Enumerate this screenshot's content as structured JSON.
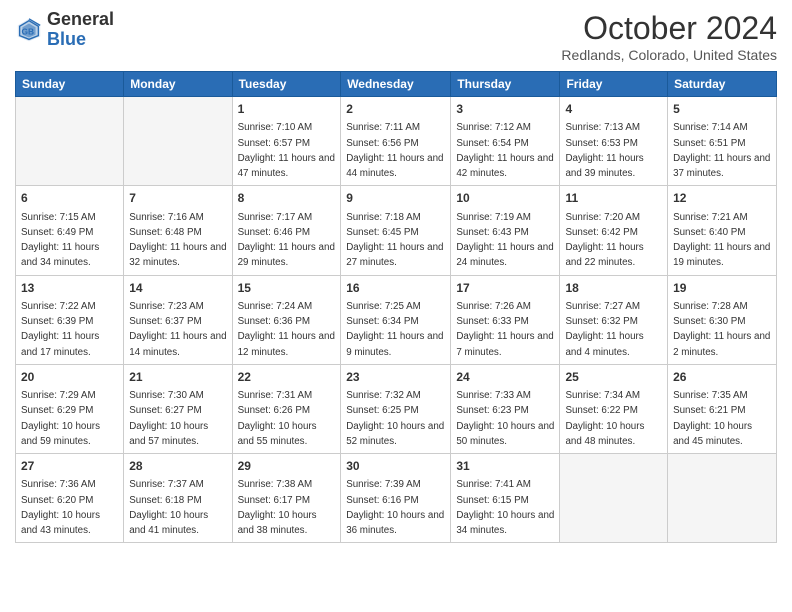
{
  "header": {
    "logo_general": "General",
    "logo_blue": "Blue",
    "title": "October 2024",
    "location": "Redlands, Colorado, United States"
  },
  "days_of_week": [
    "Sunday",
    "Monday",
    "Tuesday",
    "Wednesday",
    "Thursday",
    "Friday",
    "Saturday"
  ],
  "weeks": [
    [
      {
        "day": "",
        "detail": ""
      },
      {
        "day": "",
        "detail": ""
      },
      {
        "day": "1",
        "detail": "Sunrise: 7:10 AM\nSunset: 6:57 PM\nDaylight: 11 hours and 47 minutes."
      },
      {
        "day": "2",
        "detail": "Sunrise: 7:11 AM\nSunset: 6:56 PM\nDaylight: 11 hours and 44 minutes."
      },
      {
        "day": "3",
        "detail": "Sunrise: 7:12 AM\nSunset: 6:54 PM\nDaylight: 11 hours and 42 minutes."
      },
      {
        "day": "4",
        "detail": "Sunrise: 7:13 AM\nSunset: 6:53 PM\nDaylight: 11 hours and 39 minutes."
      },
      {
        "day": "5",
        "detail": "Sunrise: 7:14 AM\nSunset: 6:51 PM\nDaylight: 11 hours and 37 minutes."
      }
    ],
    [
      {
        "day": "6",
        "detail": "Sunrise: 7:15 AM\nSunset: 6:49 PM\nDaylight: 11 hours and 34 minutes."
      },
      {
        "day": "7",
        "detail": "Sunrise: 7:16 AM\nSunset: 6:48 PM\nDaylight: 11 hours and 32 minutes."
      },
      {
        "day": "8",
        "detail": "Sunrise: 7:17 AM\nSunset: 6:46 PM\nDaylight: 11 hours and 29 minutes."
      },
      {
        "day": "9",
        "detail": "Sunrise: 7:18 AM\nSunset: 6:45 PM\nDaylight: 11 hours and 27 minutes."
      },
      {
        "day": "10",
        "detail": "Sunrise: 7:19 AM\nSunset: 6:43 PM\nDaylight: 11 hours and 24 minutes."
      },
      {
        "day": "11",
        "detail": "Sunrise: 7:20 AM\nSunset: 6:42 PM\nDaylight: 11 hours and 22 minutes."
      },
      {
        "day": "12",
        "detail": "Sunrise: 7:21 AM\nSunset: 6:40 PM\nDaylight: 11 hours and 19 minutes."
      }
    ],
    [
      {
        "day": "13",
        "detail": "Sunrise: 7:22 AM\nSunset: 6:39 PM\nDaylight: 11 hours and 17 minutes."
      },
      {
        "day": "14",
        "detail": "Sunrise: 7:23 AM\nSunset: 6:37 PM\nDaylight: 11 hours and 14 minutes."
      },
      {
        "day": "15",
        "detail": "Sunrise: 7:24 AM\nSunset: 6:36 PM\nDaylight: 11 hours and 12 minutes."
      },
      {
        "day": "16",
        "detail": "Sunrise: 7:25 AM\nSunset: 6:34 PM\nDaylight: 11 hours and 9 minutes."
      },
      {
        "day": "17",
        "detail": "Sunrise: 7:26 AM\nSunset: 6:33 PM\nDaylight: 11 hours and 7 minutes."
      },
      {
        "day": "18",
        "detail": "Sunrise: 7:27 AM\nSunset: 6:32 PM\nDaylight: 11 hours and 4 minutes."
      },
      {
        "day": "19",
        "detail": "Sunrise: 7:28 AM\nSunset: 6:30 PM\nDaylight: 11 hours and 2 minutes."
      }
    ],
    [
      {
        "day": "20",
        "detail": "Sunrise: 7:29 AM\nSunset: 6:29 PM\nDaylight: 10 hours and 59 minutes."
      },
      {
        "day": "21",
        "detail": "Sunrise: 7:30 AM\nSunset: 6:27 PM\nDaylight: 10 hours and 57 minutes."
      },
      {
        "day": "22",
        "detail": "Sunrise: 7:31 AM\nSunset: 6:26 PM\nDaylight: 10 hours and 55 minutes."
      },
      {
        "day": "23",
        "detail": "Sunrise: 7:32 AM\nSunset: 6:25 PM\nDaylight: 10 hours and 52 minutes."
      },
      {
        "day": "24",
        "detail": "Sunrise: 7:33 AM\nSunset: 6:23 PM\nDaylight: 10 hours and 50 minutes."
      },
      {
        "day": "25",
        "detail": "Sunrise: 7:34 AM\nSunset: 6:22 PM\nDaylight: 10 hours and 48 minutes."
      },
      {
        "day": "26",
        "detail": "Sunrise: 7:35 AM\nSunset: 6:21 PM\nDaylight: 10 hours and 45 minutes."
      }
    ],
    [
      {
        "day": "27",
        "detail": "Sunrise: 7:36 AM\nSunset: 6:20 PM\nDaylight: 10 hours and 43 minutes."
      },
      {
        "day": "28",
        "detail": "Sunrise: 7:37 AM\nSunset: 6:18 PM\nDaylight: 10 hours and 41 minutes."
      },
      {
        "day": "29",
        "detail": "Sunrise: 7:38 AM\nSunset: 6:17 PM\nDaylight: 10 hours and 38 minutes."
      },
      {
        "day": "30",
        "detail": "Sunrise: 7:39 AM\nSunset: 6:16 PM\nDaylight: 10 hours and 36 minutes."
      },
      {
        "day": "31",
        "detail": "Sunrise: 7:41 AM\nSunset: 6:15 PM\nDaylight: 10 hours and 34 minutes."
      },
      {
        "day": "",
        "detail": ""
      },
      {
        "day": "",
        "detail": ""
      }
    ]
  ]
}
